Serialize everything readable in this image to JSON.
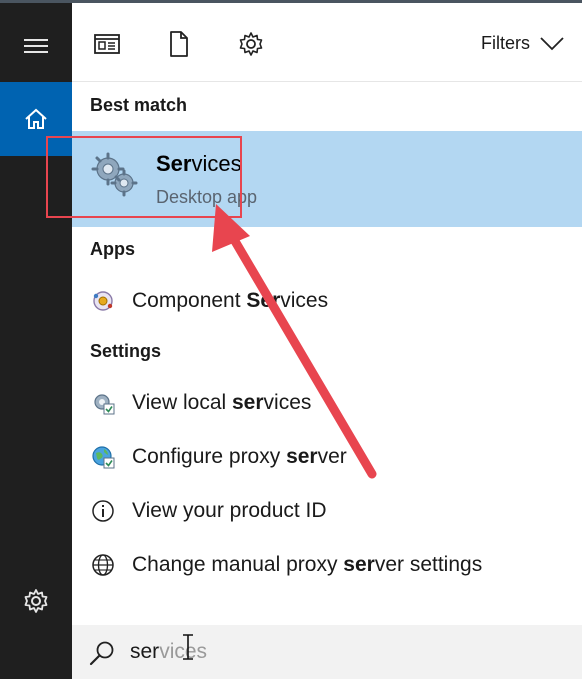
{
  "toolbar": {
    "filters_label": "Filters"
  },
  "best_match": {
    "heading": "Best match",
    "title_bold": "Ser",
    "title_rest": "vices",
    "subtitle": "Desktop app"
  },
  "apps": {
    "heading": "Apps",
    "items": [
      {
        "pre": "Component ",
        "bold": "Ser",
        "post": "vices"
      }
    ]
  },
  "settings": {
    "heading": "Settings",
    "items": [
      {
        "pre": "View local ",
        "bold": "ser",
        "post": "vices"
      },
      {
        "pre": "Configure proxy ",
        "bold": "ser",
        "post": "ver"
      },
      {
        "pre": "View your product ID",
        "bold": "",
        "post": ""
      },
      {
        "pre": "Change manual proxy ",
        "bold": "ser",
        "post": "ver settings"
      }
    ]
  },
  "search": {
    "typed": "ser",
    "ghost": "vices"
  },
  "colors": {
    "accent": "#0063b1",
    "highlight": "#b3d7f2",
    "annotation": "#e8454f"
  }
}
